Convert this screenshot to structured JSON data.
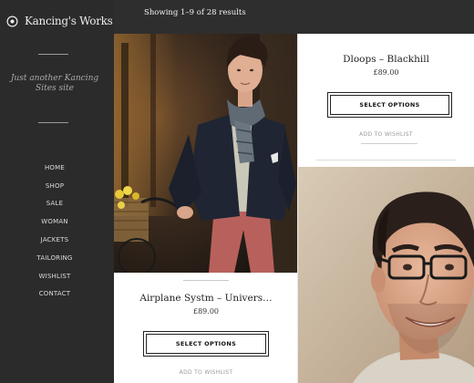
{
  "site": {
    "name": "Kancing's Works",
    "tagline": "Just another Kancing Sites site"
  },
  "nav": {
    "items": [
      "HOME",
      "SHOP",
      "SALE",
      "WOMAN",
      "JACKETS",
      "TAILORING",
      "WISHLIST",
      "CONTACT"
    ]
  },
  "shop": {
    "result_count": "Showing 1–9 of 28 results"
  },
  "products": [
    {
      "title": "Airplane Systm – Univers…",
      "price": "£89.00",
      "button": "SELECT OPTIONS",
      "wishlist": "ADD TO WISHLIST"
    },
    {
      "title": "Dloops – Blackhill",
      "price": "£89.00",
      "button": "SELECT OPTIONS",
      "wishlist": "ADD TO WISHLIST"
    }
  ],
  "colors": {
    "sidebar": "#2b2b2b",
    "topbar": "#2e2e2e",
    "text_dark": "#222222",
    "muted": "#9a9a9a"
  },
  "icons": {
    "logo": "circle-target-icon"
  }
}
